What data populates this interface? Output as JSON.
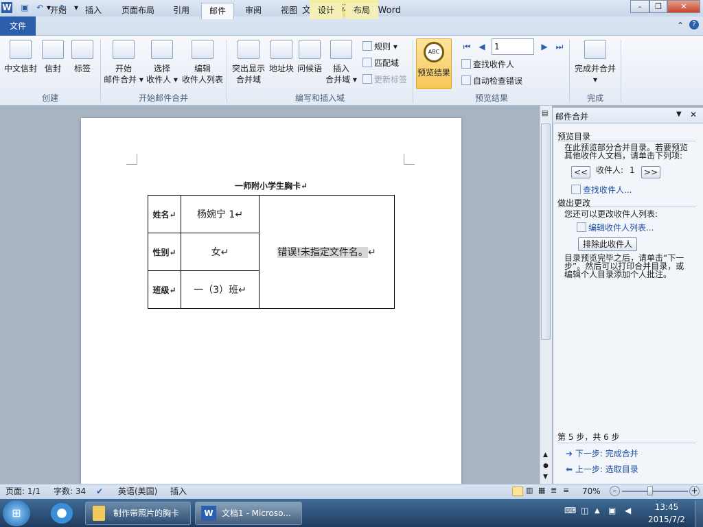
{
  "window": {
    "title": "文档1 - Microsoft Word",
    "context_tab_group": "表格工具"
  },
  "qat": {
    "undo_arrow": "▾",
    "customize": "▾"
  },
  "window_buttons": {
    "minimize": "–",
    "maximize": "❐",
    "close": "✕"
  },
  "tabs": [
    "文件",
    "开始",
    "插入",
    "页面布局",
    "引用",
    "邮件",
    "审阅",
    "视图",
    "设计",
    "布局"
  ],
  "ribbon": {
    "create_group": {
      "label": "创建",
      "buttons": [
        "中文信封",
        "信封",
        "标签"
      ]
    },
    "start_group": {
      "label": "开始邮件合并",
      "buttons": [
        {
          "line1": "开始",
          "line2": "邮件合并 ▾"
        },
        {
          "line1": "选择",
          "line2": "收件人 ▾"
        },
        {
          "line1": "编辑",
          "line2": "收件人列表"
        }
      ]
    },
    "write_group": {
      "label": "编写和插入域",
      "buttons": [
        {
          "line1": "突出显示",
          "line2": "合并域"
        },
        {
          "line1": "地址块",
          "line2": ""
        },
        {
          "line1": "问候语",
          "line2": ""
        },
        {
          "line1": "插入",
          "line2": "合并域 ▾"
        }
      ],
      "small": [
        "规则 ▾",
        "匹配域",
        "更新标签"
      ]
    },
    "preview_group": {
      "label": "预览结果",
      "preview_button": "预览结果",
      "record": "1",
      "small": [
        "查找收件人",
        "自动检查错误"
      ]
    },
    "finish_group": {
      "label": "完成",
      "button": "完成并合并",
      "arrow": "▾"
    }
  },
  "document": {
    "heading": "一师附小学生胸卡",
    "rows": [
      {
        "label": "姓名",
        "value": "杨婉宁 1"
      },
      {
        "label": "性别",
        "value": "女"
      },
      {
        "label": "班级",
        "value": "一（3）班"
      }
    ],
    "photo_field": "错误!未指定文件名。",
    "para_mark": "↵"
  },
  "pane": {
    "title": "邮件合并",
    "preview_section": "预览目录",
    "preview_text_1": "在此预览部分合并目录。若要预览",
    "preview_text_2": "其他收件人文档，请单击下列项:",
    "prev_btn": "<<",
    "next_btn": ">>",
    "recipient_label": "收件人:",
    "recipient_num": "1",
    "find_link": "查找收件人...",
    "change_section": "做出更改",
    "change_text": "您还可以更改收件人列表:",
    "edit_link": "编辑收件人列表...",
    "exclude_btn": "排除此收件人",
    "after_text_1": "目录预览完毕之后，请单击“下一",
    "after_text_2": "步”。然后可以打印合并目录，或",
    "after_text_3": "编辑个人目录添加个人批注。",
    "step_text": "第 5 步，共 6 步",
    "next_step": "下一步: 完成合并",
    "prev_step": "上一步: 选取目录"
  },
  "status": {
    "page": "页面: 1/1",
    "words": "字数: 34",
    "language": "英语(美国)",
    "mode": "插入",
    "zoom": "70%",
    "zoom_level": 0.7
  },
  "taskbar": {
    "folder_item": "制作带照片的胸卡",
    "word_item": "文档1 - Microso...",
    "time": "13:45",
    "date": "2015/7/2"
  }
}
